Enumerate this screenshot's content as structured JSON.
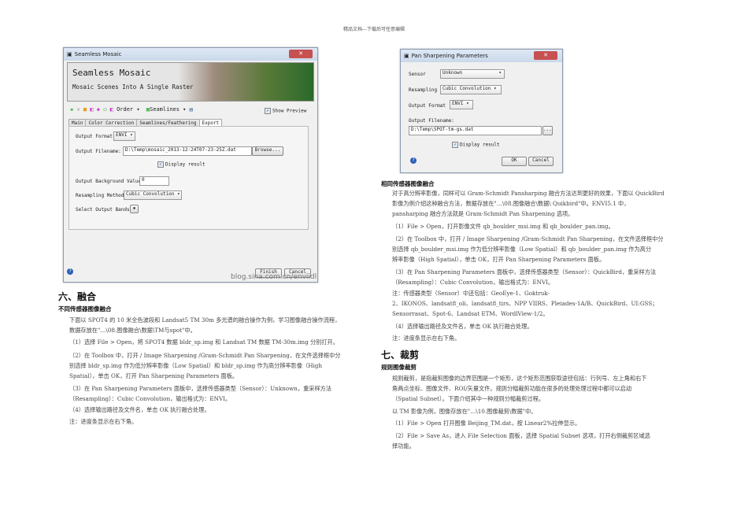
{
  "header": "精品文档---下载后可任意编辑",
  "mosaic": {
    "title": "Seamless Mosaic",
    "banner_title": "Seamless Mosaic",
    "banner_subtitle": "Mosaic Scenes Into A Single Raster",
    "order": "Order",
    "seamlines": "Seamlines",
    "show_preview": "Show Preview",
    "tabs": [
      "Main",
      "Color Correction",
      "Seamlines/Feathering",
      "Export"
    ],
    "output_format_label": "Output Format",
    "output_format": "ENVI",
    "output_filename_label": "Output Filename:",
    "output_filename": "D:\\Temp\\mosaic_2013-12-24T07-23-25Z.dat",
    "browse": "Browse...",
    "display_result": "Display result",
    "bg_label": "Output Background Value",
    "bg_value": "0",
    "resampling_label": "Resampling Method",
    "resampling": "Cubic Convolution",
    "bands_label": "Select Output Bands",
    "finish": "Finish",
    "cancel": "Cancel",
    "watermark": "blog.sina.com.cn/enviidl"
  },
  "pan": {
    "title": "Pan Sharpening Parameters",
    "sensor_label": "Sensor",
    "sensor": "Unknown",
    "resampling_label": "Resampling",
    "resampling": "Cubic Convolution",
    "format_label": "Output Format",
    "format": "ENVI",
    "filename_label": "Output Filename:",
    "filename": "D:\\Temp\\SPOT-tm-gs.dat",
    "dots": "...",
    "display_result": "Display result",
    "ok": "OK",
    "cancel": "Cancel"
  },
  "left": {
    "h1": "六、融合",
    "h2": "不同传感器图像融合",
    "lines": [
      "下面以 SPOT4 的 10 米全色波段和 Landsat5 TM 30m 多光谱的融合操作为例，学习图像融合操作流程，",
      "    数据存放在\"…\\08.图像融合\\数据\\TM与spot\"中。",
      "（1）选择 File > Open，将 SPOT4 数据 bldr_sp.img 和 Landsat TM 数据 TM-30m.img 分别打开。",
      "（2）在 Toolbox 中，打开 / Image Sharpening /Gram-Schmidt Pan Sharpening，在文件选择框中分",
      "    别选择 bldr_sp.img 作为低分辨率影像（Low Spatial）和 bldr_sp.img 作为高分辨率影像（High",
      "    Spatial），单击 OK，打开 Pan Sharpening Parameters 面板。",
      "（3）在 Pan Sharpening Parameters 面板中，选择传感器类型（Sensor）：Unknown，重采样方法",
      "    （Resampling）：Cubic Convolution，输出格式为：ENVI。",
      "（4）选择输出路径及文件名，单击 OK 执行融合处理。",
      "注：进度条显示在右下角。"
    ]
  },
  "right": {
    "h2a": "相同传感器图像融合",
    "linesA": [
      "对于高分辨率影像，同样可以 Gram-Schmidt Pansharping 融合方法达到更好的效果，下面以 QuickBird",
      "    影像为例介绍这种融合方法，数据存放在\"…\\08.图像融合\\数据\\ Quikbird\"中。ENVI5.1 中，",
      "    pansharping 融合方法就是 Gram-Schmidt Pan Sharpening 选项。",
      "（1）File > Open，打开影像文件 qb_boulder_msi.img 和 qb_boulder_pan.img。",
      "（2）在 Toolbox 中，打开 / Image Sharpening /Gram-Schmidt Pan Sharpening，在文件选择框中分",
      "    别选择 qb_boulder_msi.img 作为低分辨率影像（Low Spatial）和 qb_boulder_pan.img 作为高分",
      "    辨率影像（High Spatial），单击 OK，打开 Pan Sharpening Parameters 面板。",
      "（3）在 Pan Sharpening Parameters 面板中，选择传感器类型（Sensor）：QuickBird，重采样方法",
      "    （Resampling）：Cubic Convolution，输出格式为：ENVI。",
      "注：传感器类型（Sensor）中还包括：GeoEye-1、Goktruk-",
      "    2、IKONOS、landsat8_oli、landsat8_tirs、NPP VIIRS、Pleiades-1A/B、QuickBird、UI:GSS；",
      "    Sensorrasat、Spot-6、Landsat ETM、WordlView-1/2。",
      "（4）选择输出路径及文件名，单击 OK 执行融合处理。",
      "注：进度条显示在右下角。"
    ],
    "h1": "七、裁剪",
    "h2b": "规则图像裁剪",
    "linesB": [
      "规则裁剪，是指裁剪图像的边界范围是一个矩形，这个矩形范围获取途径包括：行列号、左上角和右下",
      "    角两点坐标、图像文件、ROI/矢量文件。规则分幅裁剪功能在很多的处理处理过程中都可以启动",
      "    （Spatial Subset）。下面介绍其中一种规则分幅裁剪过程。",
      "以 TM 影像为例，图像存放在\"…\\10.图像裁剪\\数据\"中。",
      "（1）File > Open 打开图像 Beijing_TM.dat，按 Linear2%拉伸显示。",
      "（2）File > Save As，进入 File Selection 面板，选择 Spatial Subset 选项，打开右侧裁剪区域选",
      "    择功能。"
    ]
  }
}
